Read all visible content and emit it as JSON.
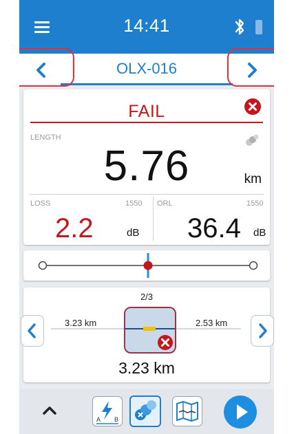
{
  "status_bar": {
    "time": "14:41",
    "icons": [
      "menu-icon",
      "bluetooth-icon",
      "battery-icon"
    ]
  },
  "title_bar": {
    "title": "OLX-016",
    "prev_icon": "chevron-left-icon",
    "next_icon": "chevron-right-icon"
  },
  "result": {
    "status": "FAIL",
    "length": {
      "label": "LENGTH",
      "value": "5.76",
      "unit": "km"
    },
    "loss": {
      "label": "LOSS",
      "wavelength": "1550",
      "value": "2.2",
      "unit": "dB"
    },
    "orl": {
      "label": "ORL",
      "wavelength": "1550",
      "value": "36.4",
      "unit": "dB"
    }
  },
  "slider": {
    "position": 0.5
  },
  "event": {
    "counter": "2/3",
    "left_distance": "3.23 km",
    "right_distance": "2.53 km",
    "total_distance": "3.23 km"
  },
  "toolbar": {
    "buttons": [
      "expand-up-icon",
      "link-a-b-icon",
      "connector-check-icon",
      "fiber-map-icon",
      "play-icon"
    ],
    "active_index": 2
  },
  "colors": {
    "primary_blue": "#1d7fce",
    "fail_red": "#c4161c",
    "highlight_red": "#e0303b",
    "background": "#e9ecef"
  }
}
